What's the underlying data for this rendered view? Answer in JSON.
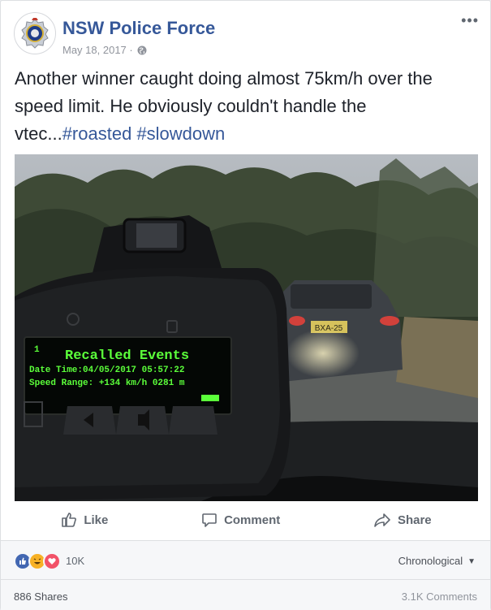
{
  "post": {
    "page_name": "NSW Police Force",
    "date": "May 18, 2017 ·",
    "text": "Another winner caught doing almost 75km/h over the speed limit. He obviously couldn't handle the vtec...",
    "hashtags": [
      "#roasted",
      "#slowdown"
    ]
  },
  "photo": {
    "screen_line1_num": "1",
    "screen_line1": "Recalled Events",
    "screen_line2": "Date Time:04/05/2017 05:57:22",
    "screen_line3": "Speed Range: +134 km/h 0281 m",
    "plate": "BXA-25"
  },
  "actions": {
    "like": "Like",
    "comment": "Comment",
    "share": "Share"
  },
  "reactions": {
    "count": "10K",
    "sort_label": "Chronological"
  },
  "footer": {
    "shares": "886 Shares",
    "comments": "3.1K Comments"
  },
  "colors": {
    "link": "#365899",
    "like_blue": "#4267b2",
    "love_red": "#f25268",
    "haha_yellow": "#f7b125",
    "screen_green": "#5bff3a"
  },
  "icons": [
    "police-badge-icon",
    "globe-icon",
    "more-options-icon",
    "thumbs-up-icon",
    "comment-icon",
    "share-icon",
    "like-reaction-icon",
    "haha-reaction-icon",
    "love-reaction-icon",
    "caret-down-icon"
  ]
}
